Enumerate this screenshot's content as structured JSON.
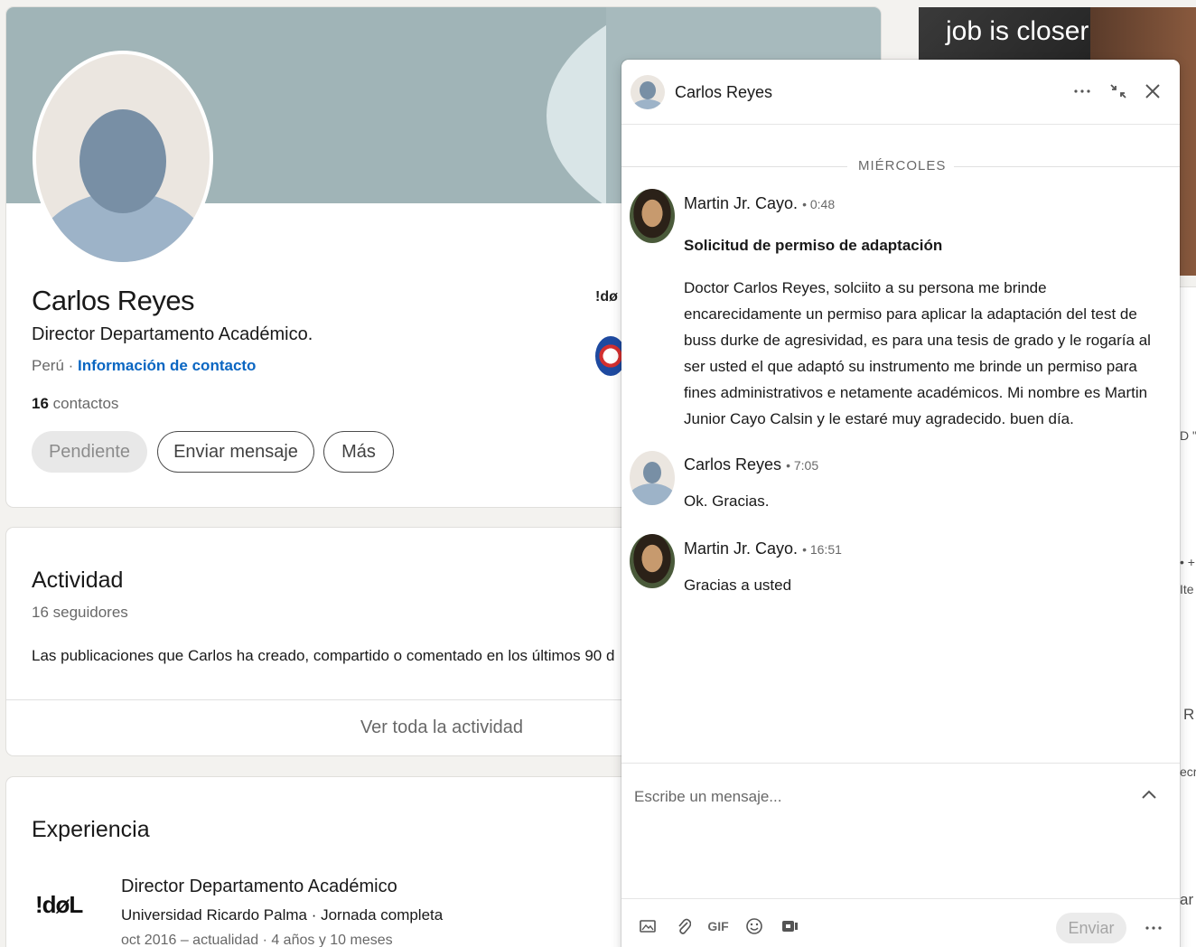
{
  "profile": {
    "name": "Carlos Reyes",
    "headline": "Director Departamento Académico.",
    "location": "Perú ·",
    "contact_link": "Información de contacto",
    "contacts_count": "16",
    "contacts_label": "contactos",
    "buttons": {
      "pending": "Pendiente",
      "message": "Enviar mensaje",
      "more": "Más"
    },
    "company_logo_text": "!dø"
  },
  "activity": {
    "title": "Actividad",
    "followers": "16 seguidores",
    "description": "Las publicaciones que Carlos ha creado, compartido o comentado en los últimos 90 d",
    "see_all": "Ver toda la actividad"
  },
  "experience": {
    "title": "Experiencia",
    "items": [
      {
        "logo_text": "!døL",
        "role": "Director Departamento Académico",
        "company": "Universidad Ricardo Palma · Jornada completa",
        "dates": "oct 2016 – actualidad · 4 años y 10 meses"
      }
    ]
  },
  "ad": {
    "text": "job is closer"
  },
  "side_fragments": [
    "D \"",
    "• +",
    "Ite",
    "R",
    "ecr",
    "ar"
  ],
  "chat": {
    "title": "Carlos Reyes",
    "header_icons": [
      "more-icon",
      "minimize-icon",
      "close-icon"
    ],
    "day_label": "MIÉRCOLES",
    "messages": [
      {
        "sender": "Martin Jr. Cayo.",
        "time": "• 0:48",
        "subject": "Solicitud de permiso de adaptación",
        "text": "Doctor Carlos Reyes, solciito a su persona me brinde encarecidamente un permiso para aplicar la adaptación del test de buss durke de agresividad, es para una tesis de grado y le rogaría al ser usted el que adaptó su instrumento me brinde un permiso para fines administrativos e netamente académicos. Mi nombre es Martin Junior Cayo Calsin y le estaré muy agradecido. buen día."
      },
      {
        "sender": "Carlos Reyes",
        "time": "• 7:05",
        "text": "Ok. Gracias."
      },
      {
        "sender": "Martin Jr. Cayo.",
        "time": "• 16:51",
        "text": "Gracias a usted"
      }
    ],
    "composer": {
      "placeholder": "Escribe un mensaje...",
      "value": ""
    },
    "toolbar": {
      "gif_label": "GIF",
      "send_label": "Enviar"
    }
  },
  "colors": {
    "link": "#0a66c2",
    "banner": "#a0b4b7",
    "page_bg": "#f3f2ef"
  }
}
